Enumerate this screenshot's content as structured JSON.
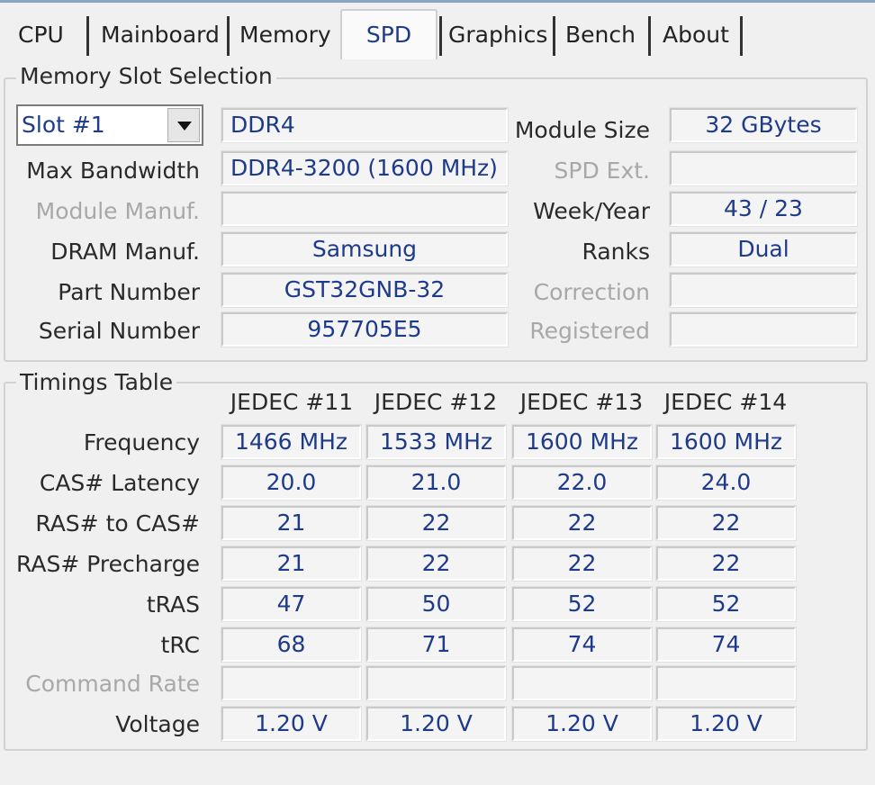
{
  "tabs": [
    "CPU",
    "Mainboard",
    "Memory",
    "SPD",
    "Graphics",
    "Bench",
    "About"
  ],
  "active_tab": "SPD",
  "slot_group": {
    "legend": "Memory Slot Selection",
    "slot_select": "Slot #1",
    "memory_type": "DDR4",
    "labels": {
      "max_bandwidth": "Max Bandwidth",
      "module_manuf": "Module Manuf.",
      "dram_manuf": "DRAM Manuf.",
      "part_number": "Part Number",
      "serial_number": "Serial Number",
      "module_size": "Module Size",
      "spd_ext": "SPD Ext.",
      "week_year": "Week/Year",
      "ranks": "Ranks",
      "correction": "Correction",
      "registered": "Registered"
    },
    "values": {
      "max_bandwidth": "DDR4-3200 (1600 MHz)",
      "module_manuf": "",
      "dram_manuf": "Samsung",
      "part_number": "GST32GNB-32",
      "serial_number": "957705E5",
      "module_size": "32 GBytes",
      "spd_ext": "",
      "week_year": "43 / 23",
      "ranks": "Dual",
      "correction": "",
      "registered": ""
    }
  },
  "timings": {
    "legend": "Timings Table",
    "columns": [
      "JEDEC #11",
      "JEDEC #12",
      "JEDEC #13",
      "JEDEC #14"
    ],
    "rows": [
      {
        "label": "Frequency",
        "values": [
          "1466 MHz",
          "1533 MHz",
          "1600 MHz",
          "1600 MHz"
        ]
      },
      {
        "label": "CAS# Latency",
        "values": [
          "20.0",
          "21.0",
          "22.0",
          "24.0"
        ]
      },
      {
        "label": "RAS# to CAS#",
        "values": [
          "21",
          "22",
          "22",
          "22"
        ]
      },
      {
        "label": "RAS# Precharge",
        "values": [
          "21",
          "22",
          "22",
          "22"
        ]
      },
      {
        "label": "tRAS",
        "values": [
          "47",
          "50",
          "52",
          "52"
        ]
      },
      {
        "label": "tRC",
        "values": [
          "68",
          "71",
          "74",
          "74"
        ]
      },
      {
        "label": "Command Rate",
        "values": [
          "",
          "",
          "",
          ""
        ]
      },
      {
        "label": "Voltage",
        "values": [
          "1.20 V",
          "1.20 V",
          "1.20 V",
          "1.20 V"
        ]
      }
    ]
  }
}
